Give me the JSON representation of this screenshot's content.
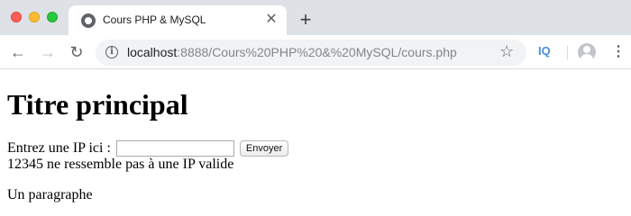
{
  "browser": {
    "tab_title": "Cours PHP & MySQL",
    "new_tab_glyph": "+",
    "tab_close_glyph": "✕",
    "url_host": "localhost",
    "url_path": ":8888/Cours%20PHP%20&%20MySQL/cours.php",
    "extension_label": "IQ",
    "icons": {
      "back": "←",
      "forward": "→",
      "reload": "↻",
      "info": "i",
      "star": "☆",
      "menu": "⋮"
    }
  },
  "page": {
    "heading": "Titre principal",
    "form": {
      "label": "Entrez une IP ici :",
      "input_value": "",
      "submit_label": "Envoyer"
    },
    "error_message": "12345 ne ressemble pas à une IP valide",
    "paragraph": "Un paragraphe"
  }
}
